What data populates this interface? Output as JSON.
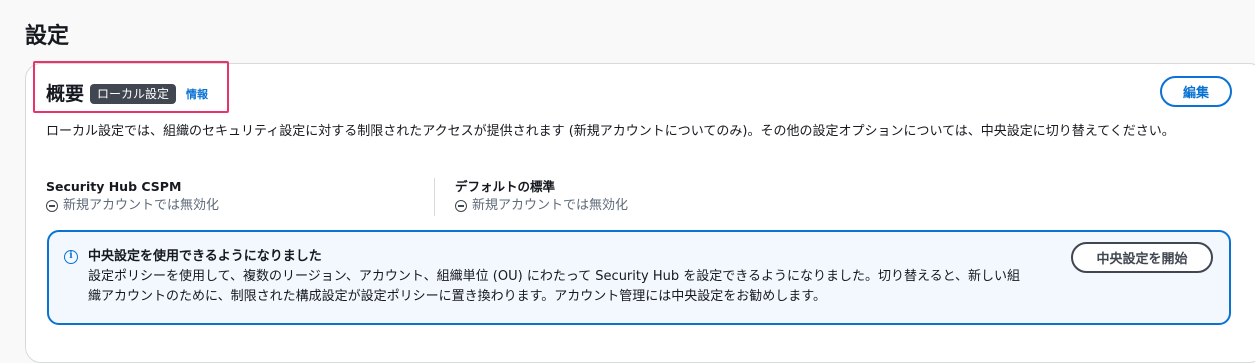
{
  "page": {
    "title": "設定"
  },
  "overview": {
    "heading": "概要",
    "badge": "ローカル設定",
    "info_link": "情報",
    "edit_label": "編集",
    "description": "ローカル設定では、組織のセキュリティ設定に対する制限されたアクセスが提供されます (新規アカウントについてのみ)。その他の設定オプションについては、中央設定に切り替えてください。"
  },
  "settings": [
    {
      "label": "Security Hub CSPM",
      "value": "新規アカウントでは無効化",
      "icon": "minus-circle-icon"
    },
    {
      "label": "デフォルトの標準",
      "value": "新規アカウントでは無効化",
      "icon": "minus-circle-icon"
    }
  ],
  "flash": {
    "icon": "info-icon",
    "title": "中央設定を使用できるようになりました",
    "body": "設定ポリシーを使用して、複数のリージョン、アカウント、組織単位 (OU) にわたって Security Hub を設定できるようになりました。切り替えると、新しい組織アカウントのために、制限された構成設定が設定ポリシーに置き換わります。アカウント管理には中央設定をお勧めします。",
    "action_label": "中央設定を開始"
  },
  "colors": {
    "accent": "#0972d3",
    "highlight": "#e8336b",
    "badge_bg": "#414750",
    "flash_bg": "#f2f8fd"
  }
}
